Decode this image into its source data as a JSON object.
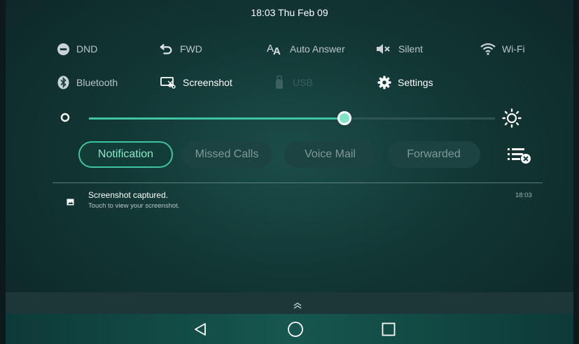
{
  "status_bar": {
    "time": "18:03 Thu Feb 09"
  },
  "quick_settings": {
    "row1": [
      {
        "label": "DND",
        "icon": "dnd-icon",
        "state": "normal"
      },
      {
        "label": "FWD",
        "icon": "forward-icon",
        "state": "normal"
      },
      {
        "label": "Auto Answer",
        "icon": "auto-answer-icon",
        "state": "normal"
      },
      {
        "label": "Silent",
        "icon": "speaker-mute-icon",
        "state": "normal"
      },
      {
        "label": "Wi-Fi",
        "icon": "wifi-icon",
        "state": "normal"
      }
    ],
    "row2": [
      {
        "label": "Bluetooth",
        "icon": "bluetooth-icon",
        "state": "normal"
      },
      {
        "label": "Screenshot",
        "icon": "screenshot-icon",
        "state": "active"
      },
      {
        "label": "USB",
        "icon": "usb-icon",
        "state": "disabled"
      },
      {
        "label": "Settings",
        "icon": "gear-icon",
        "state": "active"
      }
    ]
  },
  "brightness": {
    "level": 0.63,
    "accent": "#3fc3a0"
  },
  "tabs": [
    {
      "label": "Notification",
      "active": true
    },
    {
      "label": "Missed Calls",
      "active": false
    },
    {
      "label": "Voice Mail",
      "active": false
    },
    {
      "label": "Forwarded",
      "active": false
    }
  ],
  "notification": {
    "title": "Screenshot captured.",
    "subtitle": "Touch to view your screenshot.",
    "time": "18:03"
  }
}
